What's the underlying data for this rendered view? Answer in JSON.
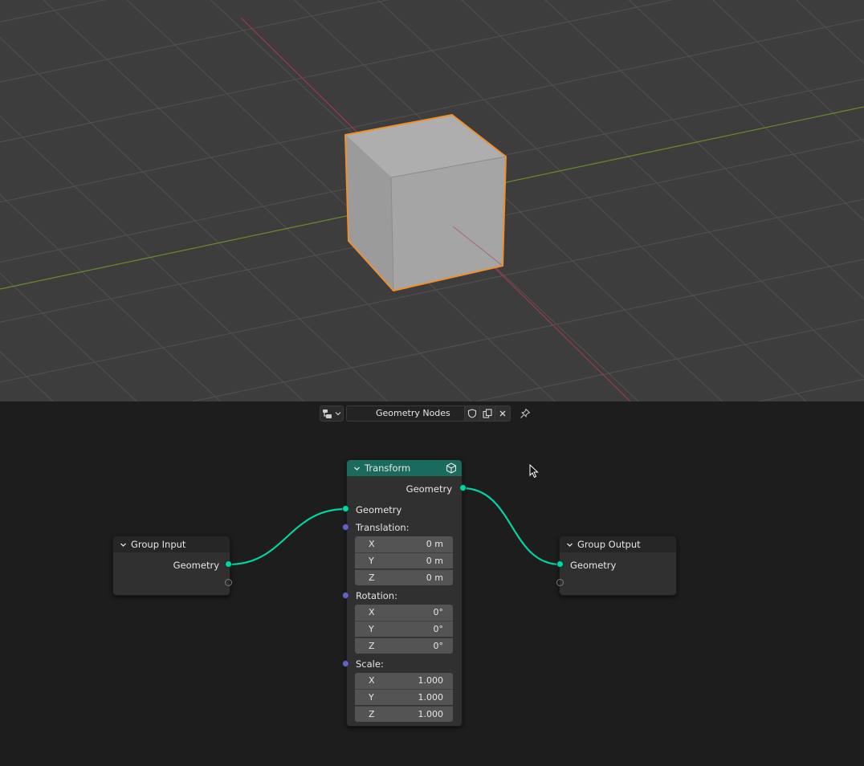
{
  "viewport": {
    "colors": {
      "background": "#3d3d3d",
      "grid": "#525252",
      "x_axis": "#a03a48",
      "y_axis": "#6c8a2b",
      "selection_outline": "#f0902a",
      "cube_top": "#aeaeae",
      "cube_left": "#9b9b9b",
      "cube_front": "#a5a5a5"
    }
  },
  "node_editor": {
    "header": {
      "editor_type_icon": "node-tree-icon",
      "node_group_name": "Geometry Nodes",
      "buttons": [
        "fake-user-shield-icon",
        "duplicate-icon",
        "unlink-x-icon"
      ],
      "pin_icon": "pin-icon"
    },
    "colors": {
      "background": "#1d1d1d",
      "geometry_socket": "#00d6a3",
      "vector_socket": "#6363c7",
      "link": "#00d6a3",
      "transform_header": "#1b6a5e"
    },
    "nodes": {
      "group_input": {
        "title": "Group Input",
        "output_label": "Geometry"
      },
      "group_output": {
        "title": "Group Output",
        "input_label": "Geometry"
      },
      "transform": {
        "title": "Transform",
        "header_icon": "cube-icon",
        "output_label": "Geometry",
        "input_label": "Geometry",
        "translation": {
          "label": "Translation:",
          "fields": [
            {
              "axis": "X",
              "value": "0 m"
            },
            {
              "axis": "Y",
              "value": "0 m"
            },
            {
              "axis": "Z",
              "value": "0 m"
            }
          ]
        },
        "rotation": {
          "label": "Rotation:",
          "fields": [
            {
              "axis": "X",
              "value": "0°"
            },
            {
              "axis": "Y",
              "value": "0°"
            },
            {
              "axis": "Z",
              "value": "0°"
            }
          ]
        },
        "scale": {
          "label": "Scale:",
          "fields": [
            {
              "axis": "X",
              "value": "1.000"
            },
            {
              "axis": "Y",
              "value": "1.000"
            },
            {
              "axis": "Z",
              "value": "1.000"
            }
          ]
        }
      }
    }
  }
}
